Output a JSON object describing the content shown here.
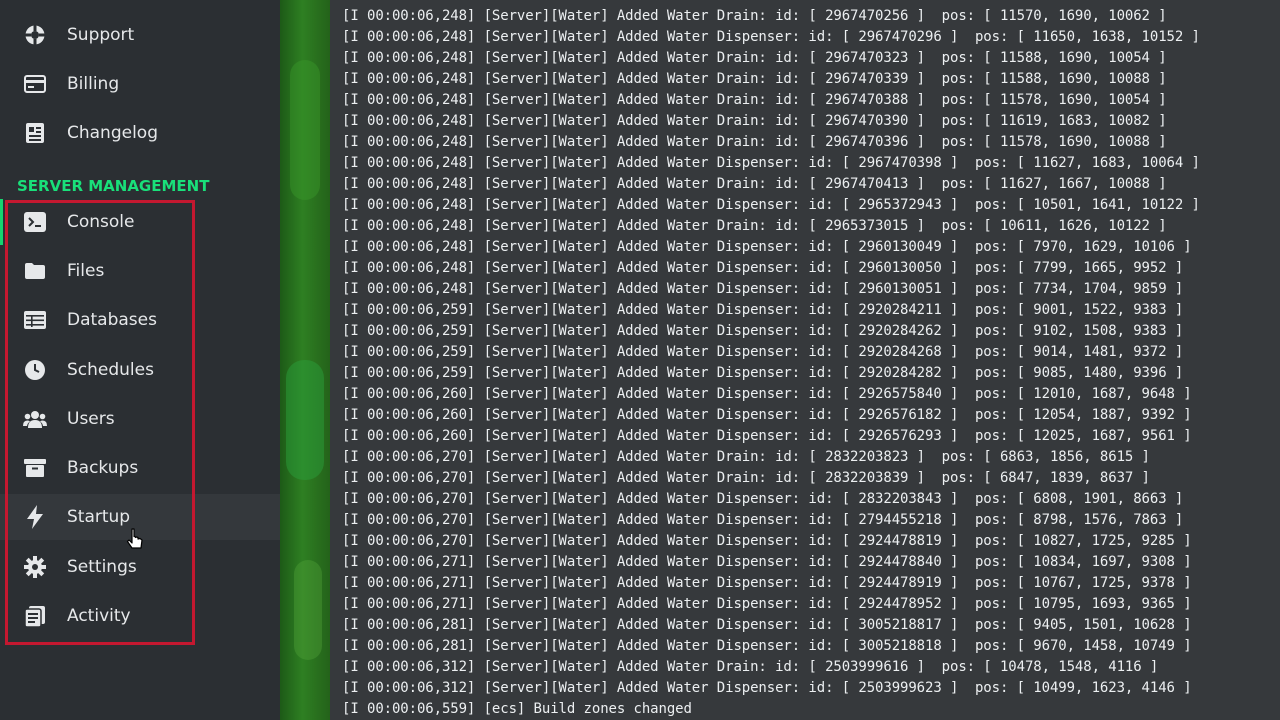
{
  "nav_top": [
    {
      "id": "support",
      "label": "Support",
      "icon": "support-icon"
    },
    {
      "id": "billing",
      "label": "Billing",
      "icon": "billing-icon"
    },
    {
      "id": "changelog",
      "label": "Changelog",
      "icon": "changelog-icon"
    }
  ],
  "section_title": "SERVER MANAGEMENT",
  "nav_server": [
    {
      "id": "console",
      "label": "Console",
      "icon": "console-icon",
      "active": true
    },
    {
      "id": "files",
      "label": "Files",
      "icon": "folder-icon"
    },
    {
      "id": "databases",
      "label": "Databases",
      "icon": "database-icon"
    },
    {
      "id": "schedules",
      "label": "Schedules",
      "icon": "clock-icon"
    },
    {
      "id": "users",
      "label": "Users",
      "icon": "users-icon"
    },
    {
      "id": "backups",
      "label": "Backups",
      "icon": "archive-icon"
    },
    {
      "id": "startup",
      "label": "Startup",
      "icon": "lightning-icon",
      "hovered": true
    },
    {
      "id": "settings",
      "label": "Settings",
      "icon": "gear-icon"
    },
    {
      "id": "activity",
      "label": "Activity",
      "icon": "activity-icon"
    }
  ],
  "colors": {
    "accent": "#19e07a",
    "highlight": "#c41830",
    "sidebar_bg": "#2b2f33",
    "console_bg": "#36393c"
  },
  "console_lines": [
    "[I 00:00:06,248] [Server][Water] Added Water Drain: id: [ 2967470256 ]  pos: [ 11570, 1690, 10062 ]",
    "[I 00:00:06,248] [Server][Water] Added Water Dispenser: id: [ 2967470296 ]  pos: [ 11650, 1638, 10152 ]",
    "[I 00:00:06,248] [Server][Water] Added Water Drain: id: [ 2967470323 ]  pos: [ 11588, 1690, 10054 ]",
    "[I 00:00:06,248] [Server][Water] Added Water Drain: id: [ 2967470339 ]  pos: [ 11588, 1690, 10088 ]",
    "[I 00:00:06,248] [Server][Water] Added Water Drain: id: [ 2967470388 ]  pos: [ 11578, 1690, 10054 ]",
    "[I 00:00:06,248] [Server][Water] Added Water Drain: id: [ 2967470390 ]  pos: [ 11619, 1683, 10082 ]",
    "[I 00:00:06,248] [Server][Water] Added Water Drain: id: [ 2967470396 ]  pos: [ 11578, 1690, 10088 ]",
    "[I 00:00:06,248] [Server][Water] Added Water Dispenser: id: [ 2967470398 ]  pos: [ 11627, 1683, 10064 ]",
    "[I 00:00:06,248] [Server][Water] Added Water Drain: id: [ 2967470413 ]  pos: [ 11627, 1667, 10088 ]",
    "[I 00:00:06,248] [Server][Water] Added Water Dispenser: id: [ 2965372943 ]  pos: [ 10501, 1641, 10122 ]",
    "[I 00:00:06,248] [Server][Water] Added Water Drain: id: [ 2965373015 ]  pos: [ 10611, 1626, 10122 ]",
    "[I 00:00:06,248] [Server][Water] Added Water Dispenser: id: [ 2960130049 ]  pos: [ 7970, 1629, 10106 ]",
    "[I 00:00:06,248] [Server][Water] Added Water Dispenser: id: [ 2960130050 ]  pos: [ 7799, 1665, 9952 ]",
    "[I 00:00:06,248] [Server][Water] Added Water Dispenser: id: [ 2960130051 ]  pos: [ 7734, 1704, 9859 ]",
    "[I 00:00:06,259] [Server][Water] Added Water Dispenser: id: [ 2920284211 ]  pos: [ 9001, 1522, 9383 ]",
    "[I 00:00:06,259] [Server][Water] Added Water Dispenser: id: [ 2920284262 ]  pos: [ 9102, 1508, 9383 ]",
    "[I 00:00:06,259] [Server][Water] Added Water Dispenser: id: [ 2920284268 ]  pos: [ 9014, 1481, 9372 ]",
    "[I 00:00:06,259] [Server][Water] Added Water Dispenser: id: [ 2920284282 ]  pos: [ 9085, 1480, 9396 ]",
    "[I 00:00:06,260] [Server][Water] Added Water Dispenser: id: [ 2926575840 ]  pos: [ 12010, 1687, 9648 ]",
    "[I 00:00:06,260] [Server][Water] Added Water Dispenser: id: [ 2926576182 ]  pos: [ 12054, 1887, 9392 ]",
    "[I 00:00:06,260] [Server][Water] Added Water Dispenser: id: [ 2926576293 ]  pos: [ 12025, 1687, 9561 ]",
    "[I 00:00:06,270] [Server][Water] Added Water Drain: id: [ 2832203823 ]  pos: [ 6863, 1856, 8615 ]",
    "[I 00:00:06,270] [Server][Water] Added Water Drain: id: [ 2832203839 ]  pos: [ 6847, 1839, 8637 ]",
    "[I 00:00:06,270] [Server][Water] Added Water Dispenser: id: [ 2832203843 ]  pos: [ 6808, 1901, 8663 ]",
    "[I 00:00:06,270] [Server][Water] Added Water Dispenser: id: [ 2794455218 ]  pos: [ 8798, 1576, 7863 ]",
    "[I 00:00:06,270] [Server][Water] Added Water Dispenser: id: [ 2924478819 ]  pos: [ 10827, 1725, 9285 ]",
    "[I 00:00:06,271] [Server][Water] Added Water Dispenser: id: [ 2924478840 ]  pos: [ 10834, 1697, 9308 ]",
    "[I 00:00:06,271] [Server][Water] Added Water Dispenser: id: [ 2924478919 ]  pos: [ 10767, 1725, 9378 ]",
    "[I 00:00:06,271] [Server][Water] Added Water Dispenser: id: [ 2924478952 ]  pos: [ 10795, 1693, 9365 ]",
    "[I 00:00:06,281] [Server][Water] Added Water Dispenser: id: [ 3005218817 ]  pos: [ 9405, 1501, 10628 ]",
    "[I 00:00:06,281] [Server][Water] Added Water Dispenser: id: [ 3005218818 ]  pos: [ 9670, 1458, 10749 ]",
    "[I 00:00:06,312] [Server][Water] Added Water Drain: id: [ 2503999616 ]  pos: [ 10478, 1548, 4116 ]",
    "[I 00:00:06,312] [Server][Water] Added Water Dispenser: id: [ 2503999623 ]  pos: [ 10499, 1623, 4146 ]",
    "[I 00:00:06,559] [ecs] Build zones changed"
  ]
}
